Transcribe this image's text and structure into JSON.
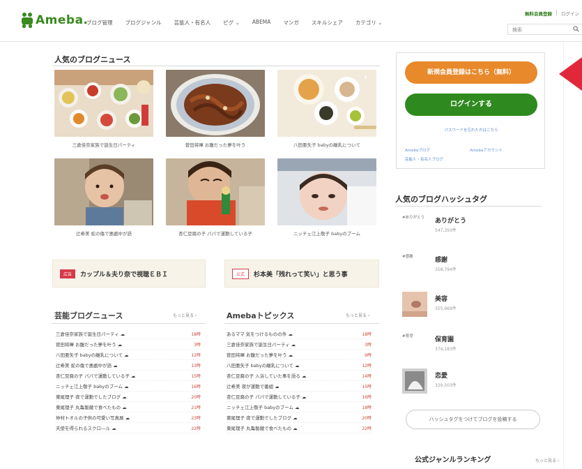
{
  "header": {
    "logo": "Ameba.",
    "nav": [
      "ブログ管理",
      "ブログジャンル",
      "芸能人・有名人",
      "ピグ ⌄",
      "ABEMA",
      "マンガ",
      "スキルシェア",
      "カテゴリ ⌄"
    ],
    "register_link": "無料会員登録",
    "login_link": "ログイン",
    "search_placeholder": "検索",
    "search_icon": "magnifier"
  },
  "news": {
    "title": "人気のブログニュース",
    "items": [
      {
        "caption": "三倉佳奈家族で誕生日パーティ"
      },
      {
        "caption": "菅田将暉 お腹だった夢を叶う"
      },
      {
        "caption": "八田亜矢子 babyの離乳について"
      },
      {
        "caption": "辻希美 蛇の傷で悪戯中が語"
      },
      {
        "caption": "杏仁豆腐の子 パパで運動している子"
      },
      {
        "caption": "ニッチェ江上敬子 babyのブーム"
      }
    ]
  },
  "banners": [
    {
      "tag": "広告",
      "text": "カップル＆夫り奈で視聴ＥＢＩ"
    },
    {
      "tag": "公式",
      "text": "杉本美「残れって笑い」と思う事"
    }
  ],
  "lists": {
    "left": {
      "title": "芸能ブログニュース",
      "more": "もっと見る ›",
      "rows": [
        {
          "t": "三倉佳奈家族で誕生日パーティ ☁",
          "c": "18時"
        },
        {
          "t": "菅田将暉 お腹だった夢を叶う ☁",
          "c": "3時"
        },
        {
          "t": "八田亜矢子 babyの離乳について ☁",
          "c": "12時"
        },
        {
          "t": "辻希美 蛇の傷で悪戯中が語 ☁",
          "c": "13時"
        },
        {
          "t": "杏仁豆腐の子 パパで運動している子 ☁",
          "c": "15時"
        },
        {
          "t": "ニッチェ江上敬子 babyのブーム ☁",
          "c": "16時"
        },
        {
          "t": "東尾理子 夜で運動でしたブログ ☁",
          "c": "20時"
        },
        {
          "t": "東尾理子 丸亀製麺で食べたもの ☁",
          "c": "21時"
        },
        {
          "t": "仲村トオルの子供の可愛い写真展 ☁",
          "c": "23時"
        },
        {
          "t": "天使を得られるスクロ―ル ☁",
          "c": "22時"
        }
      ]
    },
    "right": {
      "title": "Amebaトピックス",
      "more": "もっと見る ›",
      "rows": [
        {
          "t": "あるママ 気をつけるものの件 ☁",
          "c": "18時"
        },
        {
          "t": "三倉佳奈家族で誕生日パーティ ☁",
          "c": "3時"
        },
        {
          "t": "菅田将暉 お腹だった夢を叶う ☁",
          "c": "9時"
        },
        {
          "t": "八田亜矢子 babyの離乳について ☁",
          "c": "12時"
        },
        {
          "t": "杏仁豆腐の子 入浴していた事を語る ☁",
          "c": "14時"
        },
        {
          "t": "辻希美 夜が運動で番組 ☁",
          "c": "15時"
        },
        {
          "t": "杏仁豆腐の子 パパで運動している子 ☁",
          "c": "16時"
        },
        {
          "t": "ニッチェ江上敬子 babyのブーム ☁",
          "c": "18時"
        },
        {
          "t": "東尾理子 夜で運動でしたブログ ☁",
          "c": "20時"
        },
        {
          "t": "東尾理子 丸亀製麺で食べたもの ☁",
          "c": "22時"
        }
      ]
    }
  },
  "sidebar": {
    "register_button": "新規会員登録はこちら（無料）",
    "login_button": "ログインする",
    "forgot": "パスワードを忘れた方はこちら",
    "links": [
      "Amebaブログ",
      "Amebaアカウント",
      "芸能人・有名人ブログ"
    ],
    "hashtag_title": "人気のブログハッシュタグ",
    "hashtags": [
      {
        "label": "#ありがとう",
        "name": "ありがとう",
        "count": "547,350件"
      },
      {
        "label": "#感謝",
        "name": "感謝",
        "count": "358,794件"
      },
      {
        "label": "",
        "name": "美容",
        "count": "355,969件"
      },
      {
        "label": "#育児",
        "name": "保育園",
        "count": "374,183件"
      },
      {
        "label": "",
        "name": "恋愛",
        "count": "329,503件"
      }
    ],
    "hashtag_button": "ハッシュタグをつけてブログを投稿する",
    "ranking_title": "公式ジャンルランキング",
    "ranking_more": "もっと見る ›"
  }
}
